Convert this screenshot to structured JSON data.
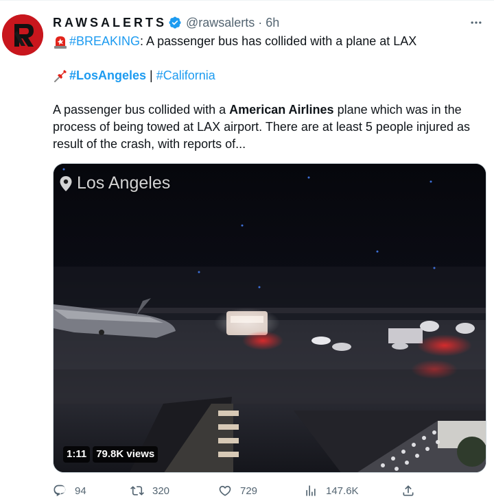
{
  "tweet": {
    "display_name": "RAWSALERTS",
    "handle": "@rawsalerts",
    "separator": "·",
    "time": "6h",
    "line1_emoji": "rotating-light-emoji",
    "line1_hashtag": "#BREAKING",
    "line1_text": ": A passenger bus has collided with a plane at LAX",
    "line2_emoji": "pushpin-emoji",
    "hashtag_la": "#LosAngeles",
    "line2_sep": "|",
    "hashtag_ca": "#California",
    "para_part1": "A passenger bus collided with a ",
    "para_bold": "American Airlines",
    "para_part2": " plane which was in the process of being towed at LAX airport. There are at least 5 people injured as result of the crash, with reports of..."
  },
  "media": {
    "location_label": "Los Angeles",
    "duration": "1:11",
    "views_badge": "79.8K views"
  },
  "actions": {
    "replies": "94",
    "retweets": "320",
    "likes": "729",
    "views": "147.6K"
  },
  "colors": {
    "accent": "#1d9bf0",
    "muted": "#536471",
    "avatar_red": "#c8161d"
  },
  "icons": [
    "verified-badge-icon",
    "more-options-icon",
    "location-pin-icon",
    "reply-icon",
    "retweet-icon",
    "like-icon",
    "views-icon",
    "share-icon"
  ]
}
